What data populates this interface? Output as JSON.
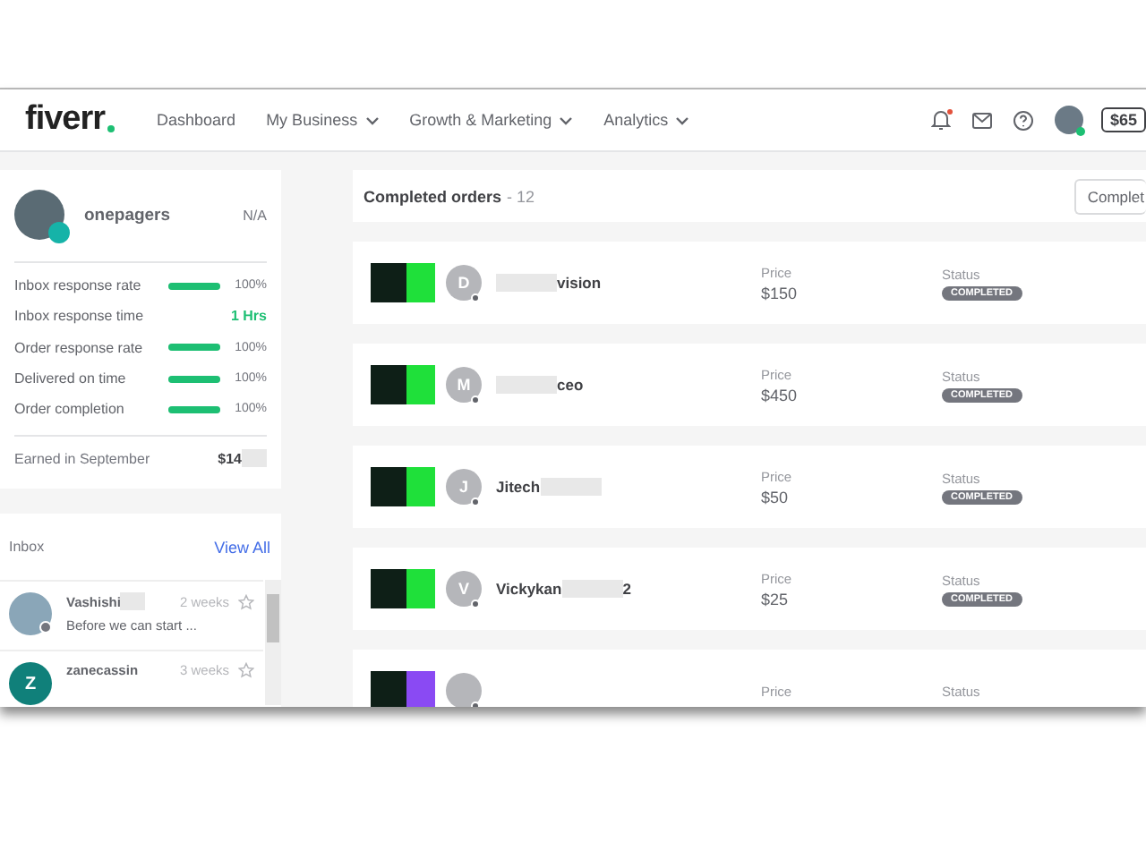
{
  "nav": {
    "logo": "fiverr",
    "links": [
      {
        "label": "Dashboard",
        "dropdown": false
      },
      {
        "label": "My Business",
        "dropdown": true
      },
      {
        "label": "Growth & Marketing",
        "dropdown": true
      },
      {
        "label": "Analytics",
        "dropdown": true
      }
    ],
    "notification_unread": true,
    "balance": "$65"
  },
  "profile": {
    "username": "onepagers",
    "rating": "N/A",
    "stats": [
      {
        "kind": "bar",
        "label": "Inbox response rate",
        "level": 1,
        "value": "100%"
      },
      {
        "kind": "text",
        "label": "Inbox response time",
        "value": "1 Hrs"
      },
      {
        "kind": "bar",
        "label": "Order response rate",
        "level": 1,
        "value": "100%"
      },
      {
        "kind": "bar",
        "label": "Delivered on time",
        "level": 1,
        "value": "100%"
      },
      {
        "kind": "bar",
        "label": "Order completion",
        "level": 1,
        "value": "100%"
      }
    ],
    "earned_label": "Earned in September",
    "earned_value": "$14"
  },
  "inbox": {
    "title": "Inbox",
    "view_all": "View All",
    "messages": [
      {
        "kind": "photo",
        "name": "Vashishi",
        "redacted": true,
        "time": "2 weeks",
        "preview": "Before we can start ..."
      },
      {
        "kind": "letter",
        "initial": "Z",
        "name": "zanecassin",
        "redacted": false,
        "time": "3 weeks"
      }
    ]
  },
  "orders": {
    "title": "Completed orders",
    "count": "- 12",
    "filter": "Complet",
    "rows": [
      {
        "color": "#1fe03a",
        "initial": "D",
        "name_before": "",
        "name_after": "vision",
        "price_label": "Price",
        "price": "$150",
        "status_label": "Status",
        "status": "COMPLETED"
      },
      {
        "color": "#1fe03a",
        "initial": "M",
        "name_before": "",
        "name_after": "ceo",
        "price_label": "Price",
        "price": "$450",
        "status_label": "Status",
        "status": "COMPLETED"
      },
      {
        "color": "#1fe03a",
        "initial": "J",
        "name_before": "Jitech",
        "name_after": "",
        "price_label": "Price",
        "price": "$50",
        "status_label": "Status",
        "status": "COMPLETED"
      },
      {
        "color": "#1fe03a",
        "initial": "V",
        "name_before": "Vickykan",
        "name_after": "2",
        "price_label": "Price",
        "price": "$25",
        "status_label": "Status",
        "status": "COMPLETED"
      },
      {
        "color": "#8a4af3",
        "price_label": "Price",
        "status_label": "Status"
      }
    ]
  }
}
